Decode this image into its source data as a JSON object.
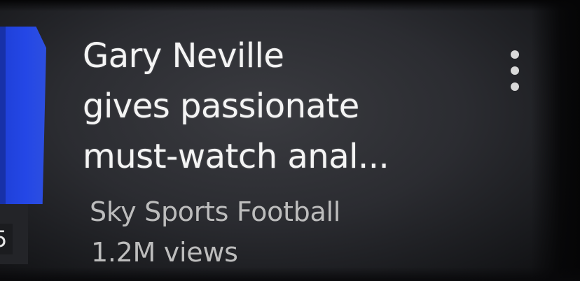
{
  "video": {
    "title_lines": [
      "Gary Neville",
      "gives passionate",
      "must-watch anal..."
    ],
    "channel": "Sky Sports Football",
    "views": "1.2M views",
    "duration_fragment": "5"
  },
  "icons": {
    "more": "more-vert-icon"
  },
  "colors": {
    "background": "#2b2c31",
    "title_text": "#f4f4f4",
    "meta_text": "#bdbdbd",
    "thumbnail_blue": "#2447e6"
  }
}
